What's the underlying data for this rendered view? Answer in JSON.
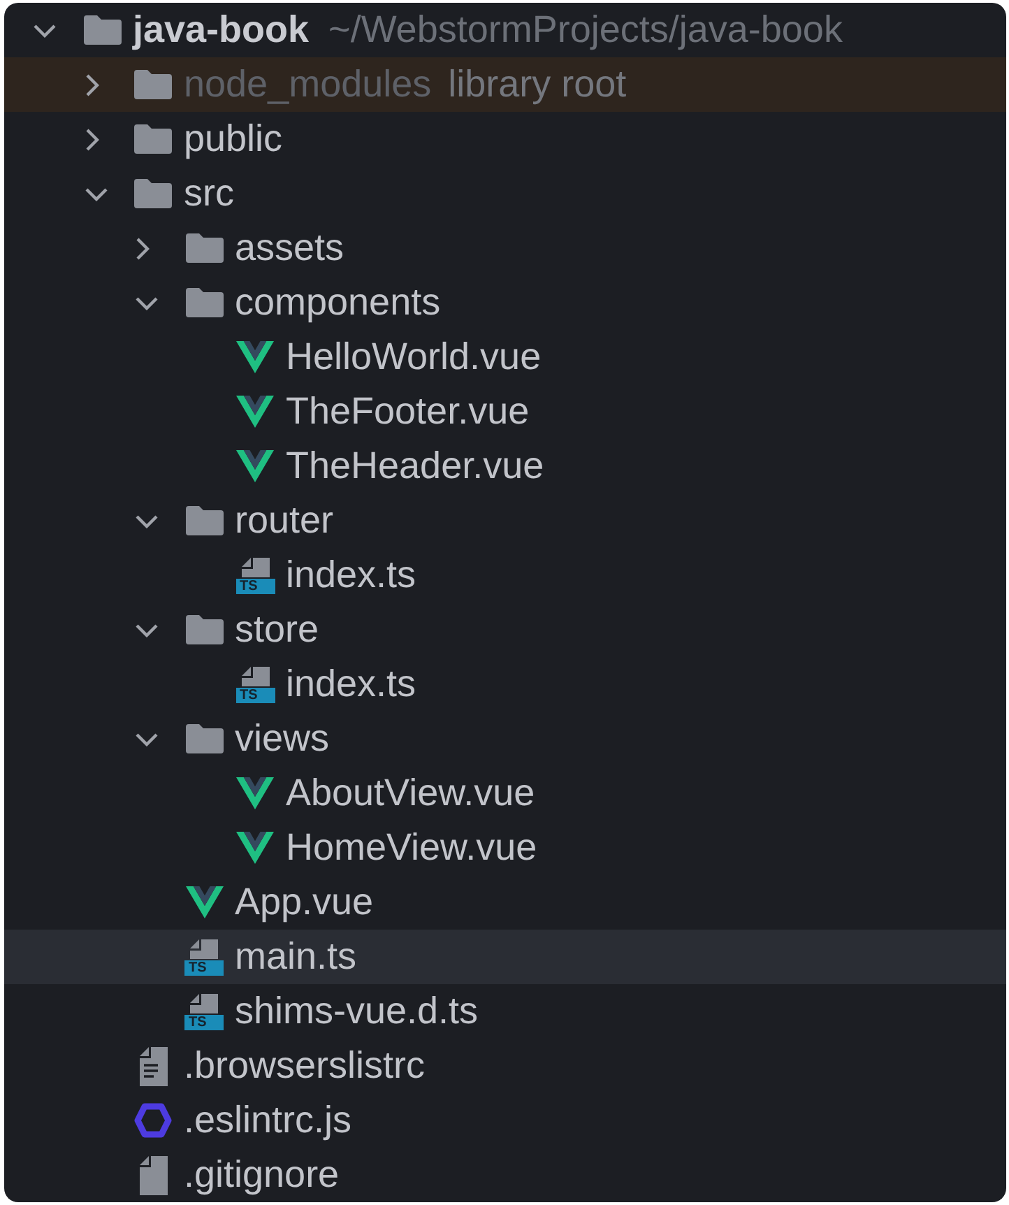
{
  "tree": [
    {
      "name": "java-book",
      "kind": "project",
      "path": "~/WebstormProjects/java-book",
      "expanded": true,
      "selected": false,
      "excluded": false,
      "children": [
        {
          "name": "node_modules",
          "kind": "folder",
          "note": "library root",
          "expanded": false,
          "selected": false,
          "excluded": true
        },
        {
          "name": "public",
          "kind": "folder",
          "expanded": false,
          "selected": false,
          "excluded": false
        },
        {
          "name": "src",
          "kind": "folder",
          "expanded": true,
          "selected": false,
          "excluded": false,
          "children": [
            {
              "name": "assets",
              "kind": "folder",
              "expanded": false,
              "selected": false,
              "excluded": false
            },
            {
              "name": "components",
              "kind": "folder",
              "expanded": true,
              "selected": false,
              "excluded": false,
              "children": [
                {
                  "name": "HelloWorld.vue",
                  "kind": "vue",
                  "selected": false,
                  "excluded": false
                },
                {
                  "name": "TheFooter.vue",
                  "kind": "vue",
                  "selected": false,
                  "excluded": false
                },
                {
                  "name": "TheHeader.vue",
                  "kind": "vue",
                  "selected": false,
                  "excluded": false
                }
              ]
            },
            {
              "name": "router",
              "kind": "folder",
              "expanded": true,
              "selected": false,
              "excluded": false,
              "children": [
                {
                  "name": "index.ts",
                  "kind": "ts",
                  "badge": "TS",
                  "selected": false,
                  "excluded": false
                }
              ]
            },
            {
              "name": "store",
              "kind": "folder",
              "expanded": true,
              "selected": false,
              "excluded": false,
              "children": [
                {
                  "name": "index.ts",
                  "kind": "ts",
                  "badge": "TS",
                  "selected": false,
                  "excluded": false
                }
              ]
            },
            {
              "name": "views",
              "kind": "folder",
              "expanded": true,
              "selected": false,
              "excluded": false,
              "children": [
                {
                  "name": "AboutView.vue",
                  "kind": "vue",
                  "selected": false,
                  "excluded": false
                },
                {
                  "name": "HomeView.vue",
                  "kind": "vue",
                  "selected": false,
                  "excluded": false
                }
              ]
            },
            {
              "name": "App.vue",
              "kind": "vue",
              "selected": false,
              "excluded": false
            },
            {
              "name": "main.ts",
              "kind": "ts",
              "badge": "TS",
              "selected": true,
              "excluded": false
            },
            {
              "name": "shims-vue.d.ts",
              "kind": "ts",
              "badge": "TS",
              "selected": false,
              "excluded": false
            }
          ]
        },
        {
          "name": ".browserslistrc",
          "kind": "text",
          "selected": false,
          "excluded": false
        },
        {
          "name": ".eslintrc.js",
          "kind": "eslint",
          "selected": false,
          "excluded": false
        },
        {
          "name": ".gitignore",
          "kind": "file",
          "selected": false,
          "excluded": false
        }
      ]
    }
  ]
}
